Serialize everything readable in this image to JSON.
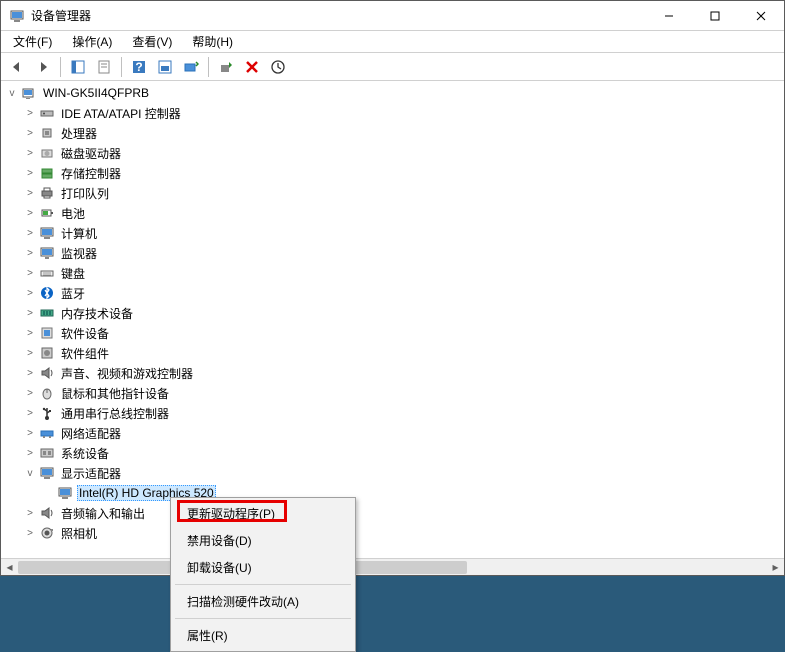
{
  "window": {
    "title": "设备管理器"
  },
  "menubar": {
    "file": "文件(F)",
    "action": "操作(A)",
    "view": "查看(V)",
    "help": "帮助(H)"
  },
  "tree": {
    "root": "WIN-GK5II4QFPRB",
    "nodes": [
      {
        "label": "IDE ATA/ATAPI 控制器",
        "icon": "ide"
      },
      {
        "label": "处理器",
        "icon": "cpu"
      },
      {
        "label": "磁盘驱动器",
        "icon": "disk"
      },
      {
        "label": "存储控制器",
        "icon": "storage"
      },
      {
        "label": "打印队列",
        "icon": "printer"
      },
      {
        "label": "电池",
        "icon": "battery"
      },
      {
        "label": "计算机",
        "icon": "computer"
      },
      {
        "label": "监视器",
        "icon": "monitor"
      },
      {
        "label": "键盘",
        "icon": "keyboard"
      },
      {
        "label": "蓝牙",
        "icon": "bluetooth"
      },
      {
        "label": "内存技术设备",
        "icon": "memory"
      },
      {
        "label": "软件设备",
        "icon": "software"
      },
      {
        "label": "软件组件",
        "icon": "component"
      },
      {
        "label": "声音、视频和游戏控制器",
        "icon": "audio"
      },
      {
        "label": "鼠标和其他指针设备",
        "icon": "mouse"
      },
      {
        "label": "通用串行总线控制器",
        "icon": "usb"
      },
      {
        "label": "网络适配器",
        "icon": "network"
      },
      {
        "label": "系统设备",
        "icon": "system"
      },
      {
        "label": "显示适配器",
        "icon": "display",
        "expanded": true,
        "children": [
          {
            "label": "Intel(R) HD Graphics 520",
            "icon": "display",
            "selected": true
          }
        ]
      },
      {
        "label": "音频输入和输出",
        "icon": "audio"
      },
      {
        "label": "照相机",
        "icon": "camera"
      }
    ]
  },
  "context_menu": {
    "update_driver": "更新驱动程序(P)",
    "disable_device": "禁用设备(D)",
    "uninstall_device": "卸载设备(U)",
    "scan_hardware": "扫描检测硬件改动(A)",
    "properties": "属性(R)"
  }
}
